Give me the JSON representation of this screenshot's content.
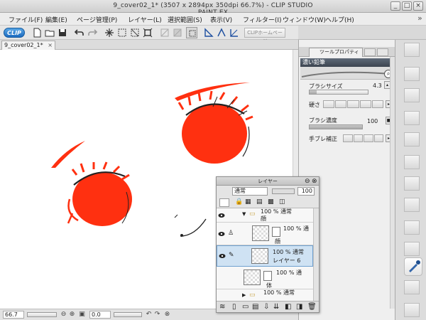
{
  "window": {
    "title": "9_cover02_1* (3507 x 2894px 350dpi 66.7%) - CLIP STUDIO PAINT EX",
    "controls": {
      "minimize": "_",
      "maximize": "□",
      "close": "×"
    }
  },
  "menubar": {
    "items": [
      "ファイル(F)",
      "編集(E)",
      "ページ管理(P)",
      "レイヤー(L)",
      "選択範囲(S)",
      "表示(V)",
      "フィルター(I)",
      "ウィンドウ(W)",
      "ヘルプ(H)"
    ],
    "overflow": "»"
  },
  "toolbar": {
    "logo": "CLIP",
    "home_button": "CLIPホームページ",
    "icons": [
      "new-icon",
      "open-icon",
      "save-icon",
      "undo-icon",
      "redo-icon",
      "transform-icon",
      "select-all-icon",
      "deselect-icon",
      "crop-icon",
      "clear-icon",
      "fill-icon",
      "selection-border-icon",
      "ruler-icon",
      "snap-icon",
      "special-ruler-icon"
    ]
  },
  "document_tab": {
    "label": "9_cover02_1*",
    "close": "×"
  },
  "tool_property": {
    "tab_label": "ツールプロパティ",
    "tool_name": "濃い鉛筆",
    "brush_size": {
      "label": "ブラシサイズ",
      "value": "4.3",
      "level": 0.12
    },
    "hardness": {
      "label": "硬さ"
    },
    "density": {
      "label": "ブラシ濃度",
      "value": "100",
      "level": 1.0
    },
    "stabilization": {
      "label": "手ブレ補正"
    }
  },
  "layer_panel": {
    "title": "レイヤー",
    "blend_mode": "通常",
    "opacity": "100",
    "layers": [
      {
        "name": "顔",
        "mode": "100 % 通常",
        "type": "folder",
        "visible": true
      },
      {
        "name": "顔",
        "mode": "100 % 通",
        "type": "masked",
        "visible": true
      },
      {
        "name": "レイヤー 6",
        "mode": "100 % 通常",
        "type": "raster",
        "visible": true,
        "selected": true
      },
      {
        "name": "体",
        "mode": "100 % 通",
        "type": "masked",
        "visible": false
      },
      {
        "name": "",
        "mode": "100 % 通常",
        "type": "folder",
        "visible": false
      }
    ]
  },
  "statusbar": {
    "zoom": "66.7",
    "angle": "0.0"
  },
  "colors": {
    "eye_red": "#ff3010",
    "title_bar": "#d6d6d6",
    "selected_layer": "#cfe2f3",
    "tool_name_bar": "#47505c"
  }
}
